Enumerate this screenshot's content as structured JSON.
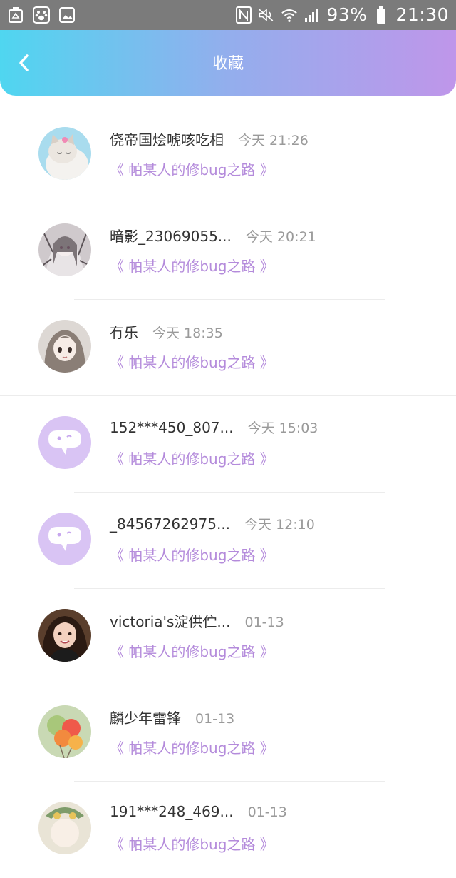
{
  "status_bar": {
    "battery": "93%",
    "time": "21:30",
    "left_icons": [
      "recycle-icon",
      "baidu-paw-icon",
      "gallery-icon"
    ],
    "right_icons": [
      "nfc-icon",
      "mute-icon",
      "wifi-icon",
      "signal-icon",
      "battery-icon"
    ]
  },
  "header": {
    "title": "收藏",
    "back_icon": "chevron-left-icon",
    "gradient": [
      "#4fd6f0",
      "#93aeed",
      "#bf96ea"
    ]
  },
  "colors": {
    "accent": "#b48bdb",
    "name": "#333333",
    "time": "#9a9a9a"
  },
  "items": [
    {
      "name": "侥帝国烩唬咳吃相",
      "time": "今天 21:26",
      "subtitle": "《 帕某人的修bug之路 》",
      "avatar": "cat-photo"
    },
    {
      "name": "暗影_23069055...",
      "time": "今天 20:21",
      "subtitle": "《 帕某人的修bug之路 》",
      "avatar": "anime-girl-sketch"
    },
    {
      "name": "冇乐",
      "time": "今天 18:35",
      "subtitle": "《 帕某人的修bug之路 》",
      "avatar": "anime-girl"
    },
    {
      "name": "152***450_807...",
      "time": "今天 15:03",
      "subtitle": "《 帕某人的修bug之路 》",
      "avatar": "default-chat-bubble"
    },
    {
      "name": "_84567262975...",
      "time": "今天 12:10",
      "subtitle": "《 帕某人的修bug之路 》",
      "avatar": "default-chat-bubble"
    },
    {
      "name": "victoria's淀供伫...",
      "time": "01-13",
      "subtitle": "《 帕某人的修bug之路 》",
      "avatar": "girl-photo"
    },
    {
      "name": "麟少年雷锋",
      "time": "01-13",
      "subtitle": "《 帕某人的修bug之路 》",
      "avatar": "balloons-photo"
    },
    {
      "name": "191***248_469...",
      "time": "01-13",
      "subtitle": "《 帕某人的修bug之路 》",
      "avatar": "cartoon"
    }
  ]
}
